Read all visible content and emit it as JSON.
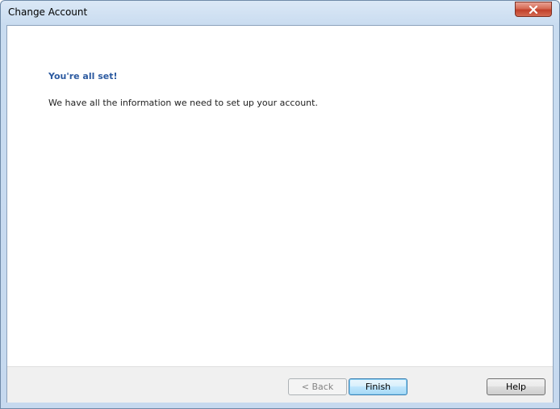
{
  "window": {
    "title": "Change Account"
  },
  "content": {
    "heading": "You're all set!",
    "message": "We have all the information we need to set up your account."
  },
  "footer": {
    "back_label": "< Back",
    "finish_label": "Finish",
    "help_label": "Help"
  },
  "icons": {
    "close": "close-icon"
  },
  "colors": {
    "heading": "#2c5aa0",
    "close_button": "#c1402a",
    "default_button_border": "#3c7fb1"
  }
}
